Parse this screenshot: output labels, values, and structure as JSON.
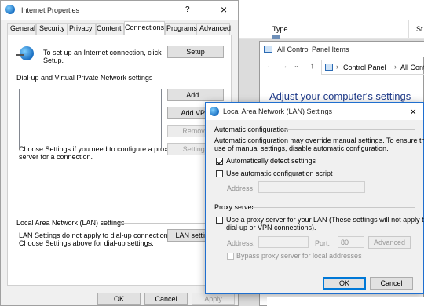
{
  "internet_properties": {
    "title": "Internet Properties",
    "help": "?",
    "close": "×",
    "tabs": [
      "General",
      "Security",
      "Privacy",
      "Content",
      "Connections",
      "Programs",
      "Advanced"
    ],
    "intro_text_1": "To set up an Internet connection, click",
    "intro_text_2": "Setup.",
    "setup_button": "Setup",
    "dialup_heading": "Dial-up and Virtual Private Network settings",
    "add_button": "Add...",
    "add_vpn_button": "Add VPN",
    "remove_button": "Remove",
    "settings_button": "Settings",
    "proxy_text_1": "Choose Settings if you need to configure a proxy",
    "proxy_text_2": "server for a connection.",
    "lan_heading": "Local Area Network (LAN) settings",
    "lan_text_1": "LAN Settings do not apply to dial-up connections.",
    "lan_text_2": "Choose Settings above for dial-up settings.",
    "lan_settings_button": "LAN settings",
    "ok": "OK",
    "cancel": "Cancel",
    "apply": "Apply"
  },
  "control_panel": {
    "title": "All Control Panel Items",
    "breadcrumb_1": "Control Panel",
    "breadcrumb_2": "All Control Panel Items",
    "heading": "Adjust your computer's settings",
    "bg_column_type": "Type",
    "bg_column_s": "St"
  },
  "lan_dialog": {
    "title": "Local Area Network (LAN) Settings",
    "close": "×",
    "auto_heading": "Automatic configuration",
    "auto_text_1": "Automatic configuration may override manual settings.  To ensure the",
    "auto_text_2": "use of manual settings, disable automatic configuration.",
    "auto_detect": "Automatically detect settings",
    "auto_detect_checked": true,
    "use_script": "Use automatic configuration script",
    "use_script_checked": false,
    "address_label": "Address",
    "proxy_heading": "Proxy server",
    "use_proxy_1": "Use a proxy server for your LAN (These settings will not apply to",
    "use_proxy_2": "dial-up or VPN connections).",
    "use_proxy_checked": false,
    "proxy_address_label": "Address:",
    "port_label": "Port:",
    "port_value": "80",
    "advanced_button": "Advanced",
    "bypass_label": "Bypass proxy server for local addresses",
    "ok": "OK",
    "cancel": "Cancel"
  }
}
